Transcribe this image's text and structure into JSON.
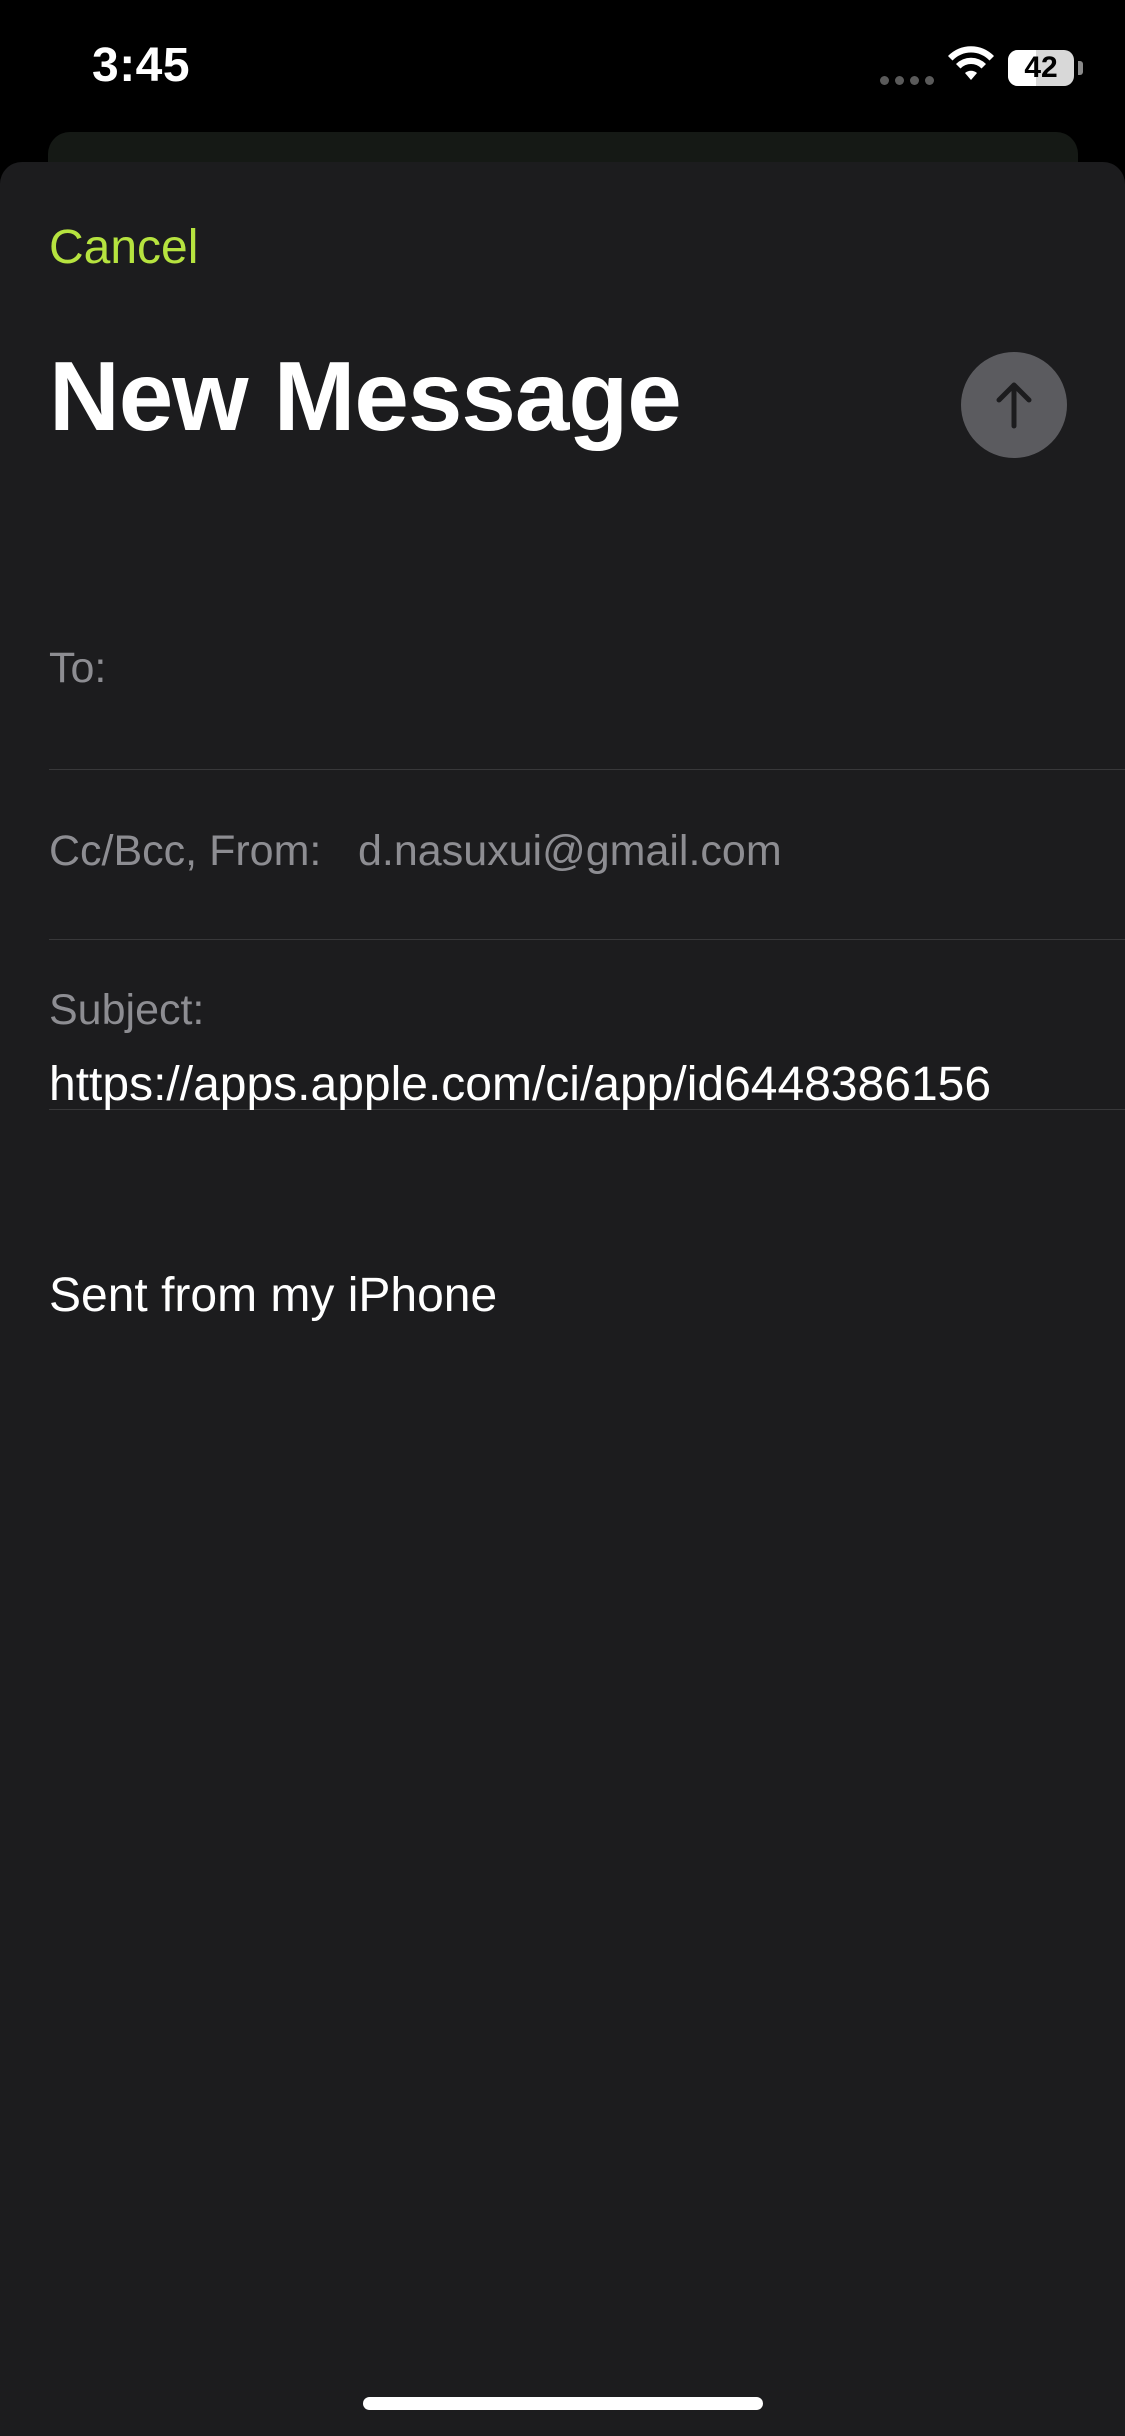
{
  "status_bar": {
    "time": "3:45",
    "battery_level": "42",
    "battery_fraction": 0.42,
    "icons": [
      "cellular-signal-icon",
      "wifi-icon",
      "battery-icon"
    ]
  },
  "compose": {
    "cancel_label": "Cancel",
    "title": "New Message",
    "send_icon": "arrow-up-icon",
    "fields": {
      "to_label": "To:",
      "to_value": "",
      "cc_bcc_from_label": "Cc/Bcc, From:",
      "from_value": "d.nasuxui@gmail.com",
      "subject_label": "Subject:",
      "subject_value": ""
    },
    "body": "https://apps.apple.com/ci/app/id6448386156",
    "signature": "Sent from my iPhone"
  },
  "colors": {
    "accent": "#b6e33f",
    "sheet_background": "#1c1c1e",
    "secondary_text": "#8d8d92",
    "send_button": "#5b5b5f"
  }
}
